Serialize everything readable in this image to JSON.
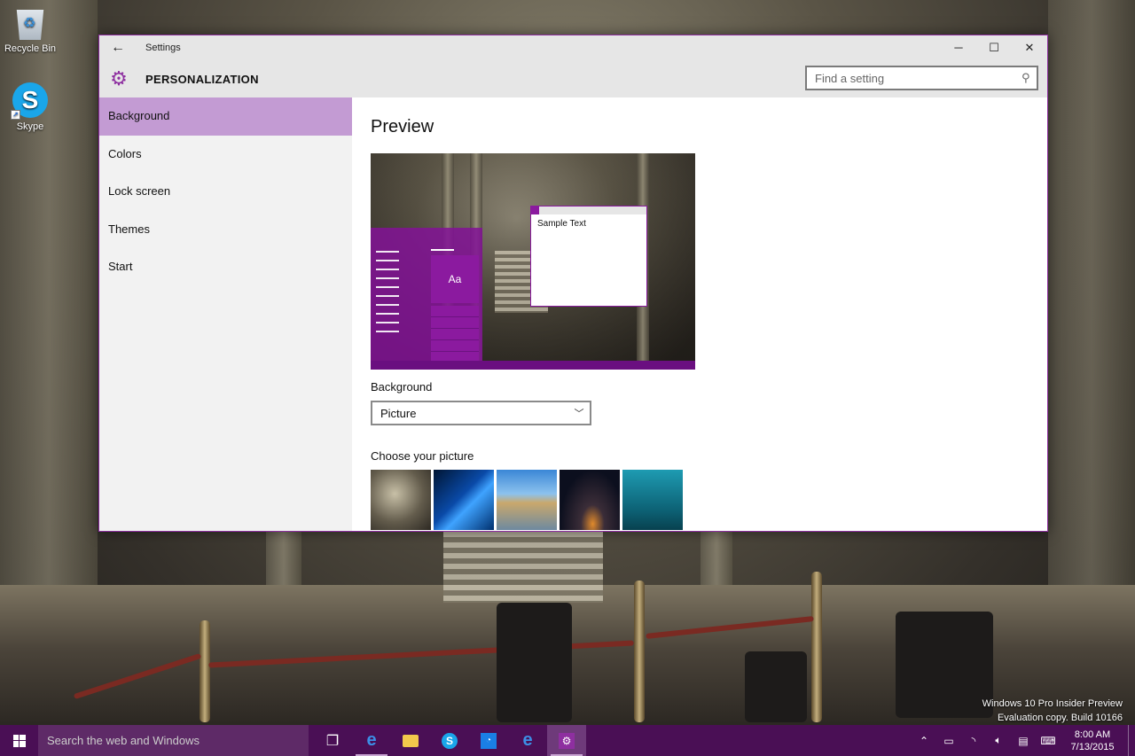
{
  "desktop": {
    "icons": [
      {
        "label": "Recycle Bin",
        "icon": "recycle-bin-icon"
      },
      {
        "label": "Skype",
        "icon": "skype-icon"
      }
    ],
    "watermark": [
      "Windows 10 Pro Insider Preview",
      "Evaluation copy. Build 10166"
    ]
  },
  "window": {
    "app_title": "Settings",
    "section_title": "PERSONALIZATION",
    "search_placeholder": "Find a setting",
    "controls": {
      "minimize": "─",
      "maximize": "☐",
      "close": "✕"
    },
    "accent_color": "#8e2fa0"
  },
  "sidebar": {
    "items": [
      {
        "label": "Background",
        "active": true
      },
      {
        "label": "Colors",
        "active": false
      },
      {
        "label": "Lock screen",
        "active": false
      },
      {
        "label": "Themes",
        "active": false
      },
      {
        "label": "Start",
        "active": false
      }
    ]
  },
  "main": {
    "preview_title": "Preview",
    "preview_sample_text": "Sample Text",
    "preview_tile_text": "Aa",
    "background_label": "Background",
    "background_value": "Picture",
    "choose_label": "Choose your picture",
    "pictures": [
      "museum-hall",
      "windows-hero",
      "beach-rock",
      "night-sky",
      "underwater"
    ]
  },
  "taskbar": {
    "search_placeholder": "Search the web and Windows",
    "apps": [
      "task-view",
      "edge",
      "file-explorer",
      "skype",
      "store",
      "internet-explorer",
      "settings"
    ],
    "time": "8:00 AM",
    "date": "7/13/2015"
  }
}
